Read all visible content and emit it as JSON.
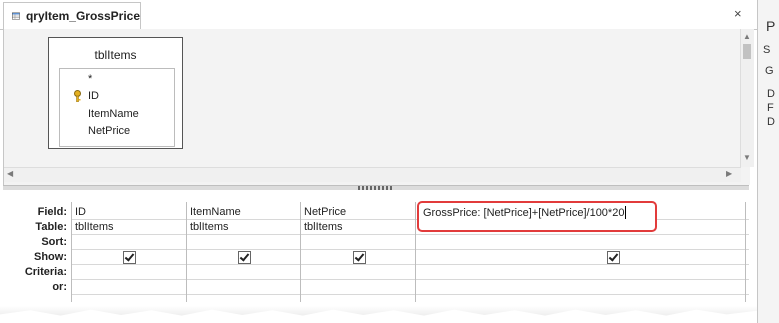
{
  "tab": {
    "title": "qryItem_GrossPrice",
    "close": "×"
  },
  "table_box": {
    "name": "tblItems",
    "fields": [
      "*",
      "ID",
      "ItemName",
      "NetPrice"
    ]
  },
  "grid": {
    "row_labels": [
      "Field:",
      "Table:",
      "Sort:",
      "Show:",
      "Criteria:",
      "or:"
    ],
    "columns": [
      {
        "field": "ID",
        "table": "tblItems",
        "show": true
      },
      {
        "field": "ItemName",
        "table": "tblItems",
        "show": true
      },
      {
        "field": "NetPrice",
        "table": "tblItems",
        "show": true
      },
      {
        "field": "GrossPrice: [NetPrice]+[NetPrice]/100*20",
        "table": "",
        "show": true
      }
    ]
  },
  "right_pane": {
    "fragments": [
      "P",
      "S",
      "G",
      "D",
      "F",
      "D"
    ]
  },
  "colors": {
    "highlight": "#e23b3b",
    "upper_bg": "#f3f3f3"
  }
}
